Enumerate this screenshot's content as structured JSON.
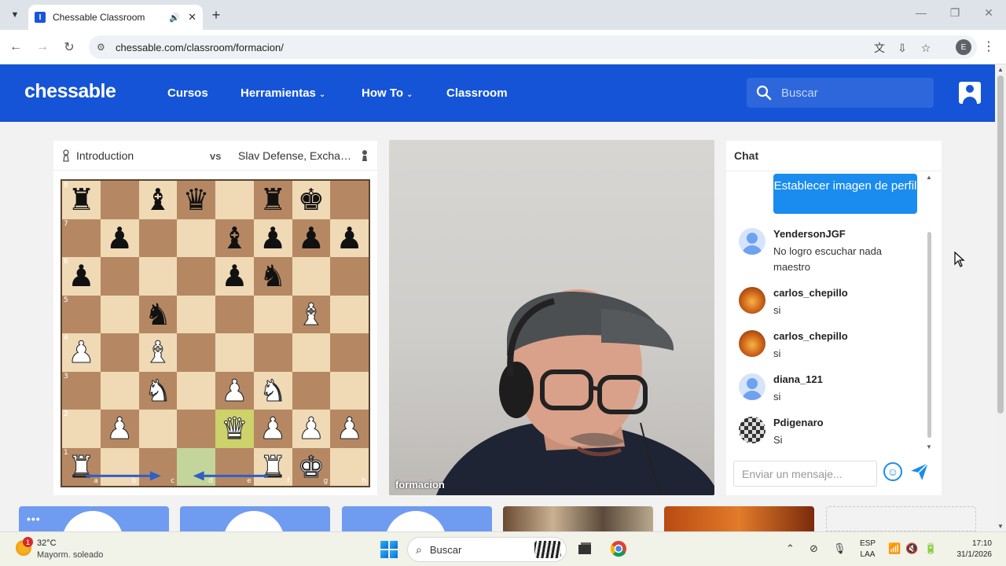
{
  "browser": {
    "tab_title": "Chessable Classroom",
    "url": "chessable.com/classroom/formacion/",
    "profile_initial": "E"
  },
  "header": {
    "logo": "chessable",
    "nav": [
      {
        "label": "Cursos",
        "has_menu": false
      },
      {
        "label": "Herramientas",
        "has_menu": true
      },
      {
        "label": "How To",
        "has_menu": true
      },
      {
        "label": "Classroom",
        "has_menu": false
      }
    ],
    "search_placeholder": "Buscar"
  },
  "board_panel": {
    "player_left": "Introduction",
    "vs": "vs",
    "player_right": "Slav Defense, Exchan...",
    "files": [
      "a",
      "b",
      "c",
      "d",
      "e",
      "f",
      "g",
      "h"
    ],
    "ranks": [
      "8",
      "7",
      "6",
      "5",
      "4",
      "3",
      "2",
      "1"
    ],
    "position": [
      [
        "bR",
        "",
        "bB",
        "bQ",
        "",
        "bR",
        "bK",
        ""
      ],
      [
        "",
        "bP",
        "",
        "",
        "bB",
        "bP",
        "bP",
        "bP"
      ],
      [
        "bP",
        "",
        "",
        "",
        "bP",
        "bN",
        "",
        ""
      ],
      [
        "",
        "",
        "bN",
        "",
        "",
        "",
        "wB",
        ""
      ],
      [
        "wP",
        "",
        "wB",
        "",
        "",
        "",
        "",
        ""
      ],
      [
        "",
        "",
        "wN",
        "",
        "wP",
        "wN",
        "",
        ""
      ],
      [
        "",
        "wP",
        "",
        "",
        "wQ",
        "wP",
        "wP",
        "wP"
      ],
      [
        "wR",
        "",
        "",
        "",
        "",
        "wR",
        "wK",
        ""
      ]
    ],
    "highlight_yellow": [
      "e2"
    ],
    "highlight_green": [
      "d1"
    ],
    "arrows": [
      [
        "a1",
        "c1"
      ],
      [
        "f1",
        "d1"
      ]
    ]
  },
  "video": {
    "participant_label": "formacion"
  },
  "chat": {
    "title": "Chat",
    "set_avatar_button": "Establecer imagen de perfil",
    "messages": [
      {
        "user": "YendersonJGF",
        "text": "No logro escuchar nada maestro",
        "avatar": "default"
      },
      {
        "user": "carlos_chepillo",
        "text": "si",
        "avatar": "fire"
      },
      {
        "user": "carlos_chepillo",
        "text": "si",
        "avatar": "fire"
      },
      {
        "user": "diana_121",
        "text": "si",
        "avatar": "default"
      },
      {
        "user": "Pdigenaro",
        "text": "Si",
        "avatar": "chess"
      }
    ],
    "input_placeholder": "Enviar un mensaje..."
  },
  "participants_strip": {
    "more_label": "•••"
  },
  "taskbar": {
    "weather_temp": "32°C",
    "weather_desc": "Mayorm. soleado",
    "weather_badge": "1",
    "search_label": "Buscar",
    "lang_line1": "ESP",
    "lang_line2": "LAA",
    "time": "17:10",
    "date": "31/1/2026"
  },
  "colors": {
    "brand_blue": "#1554d6",
    "chat_button": "#1a8cf0",
    "board_light": "#f0d9b5",
    "board_dark": "#b58863",
    "arrow": "#2f5fc4"
  }
}
